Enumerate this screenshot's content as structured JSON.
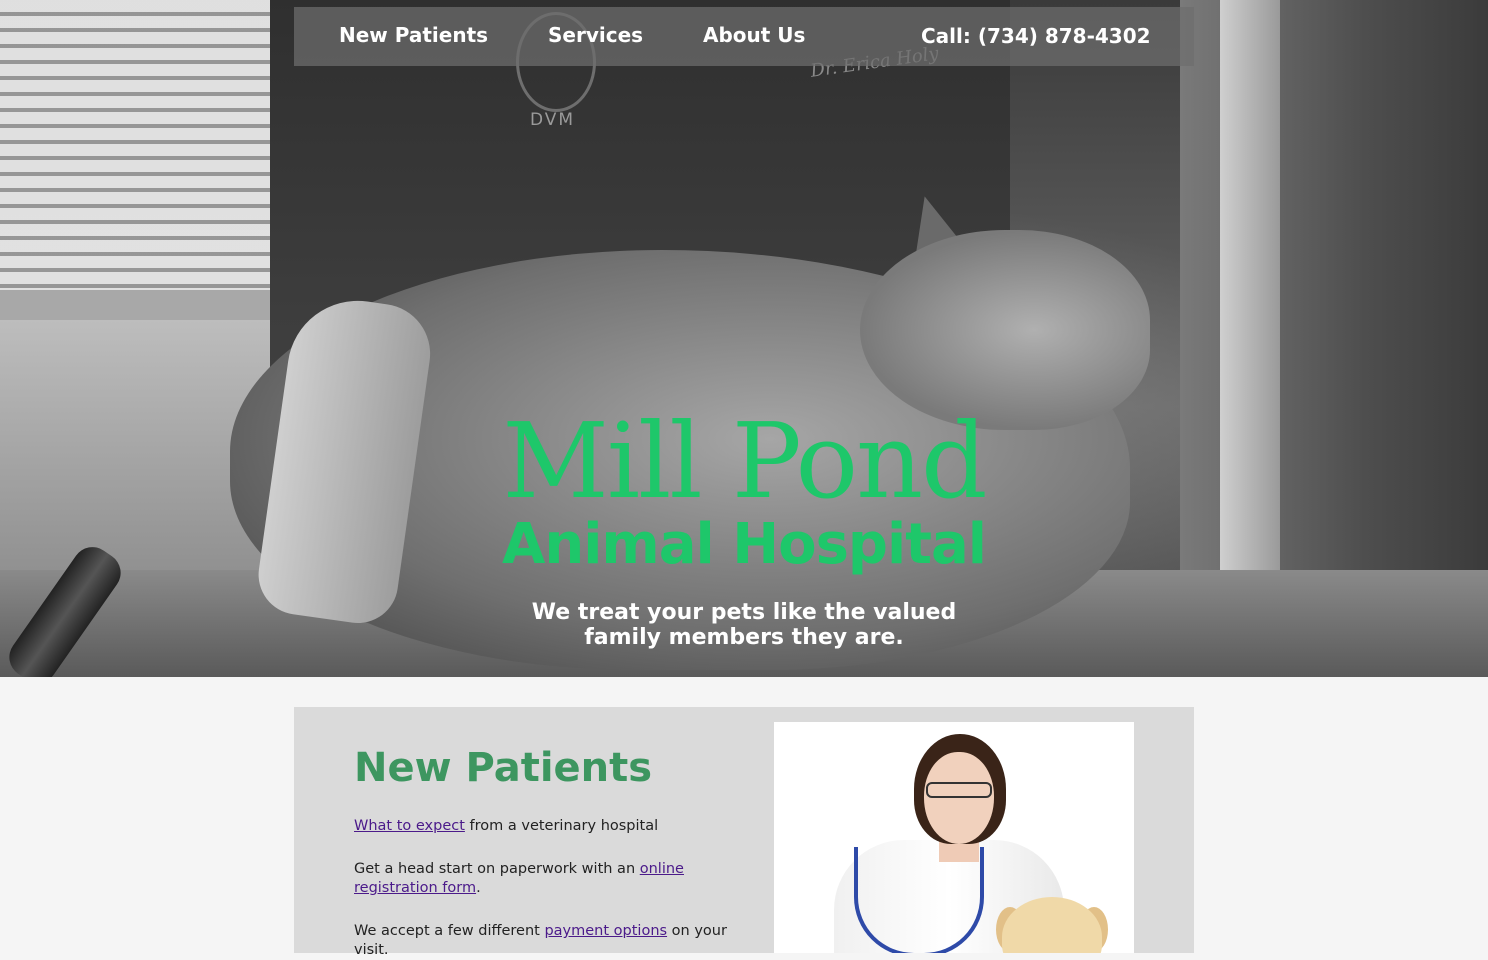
{
  "nav": {
    "items": [
      {
        "label": "New Patients"
      },
      {
        "label": "Services"
      },
      {
        "label": "About Us"
      }
    ],
    "phone": "Call: (734) 878-4302"
  },
  "hero": {
    "title": "Mill Pond",
    "subtitle": "Animal Hospital",
    "tagline": "We treat your pets like the valued family members they are.",
    "photo_text": {
      "badge": "DVM",
      "embroidery": "Dr. Erica Holy"
    }
  },
  "section": {
    "title": "New Patients",
    "p1": {
      "link": "What to expect",
      "text": " from a veterinary hospital"
    },
    "p2": {
      "text": "Get a head start on paperwork with an ",
      "link": "online registration form",
      "end": "."
    },
    "p3": {
      "text": "We accept a few different ",
      "link": "payment options",
      "end": " on your visit."
    }
  },
  "colors": {
    "brand_green": "#1ec76a",
    "heading_green": "#3d9660",
    "link_purple": "#4b1a8a",
    "card_bg": "#dadada",
    "nav_bg": "rgba(110,110,110,0.72)"
  }
}
